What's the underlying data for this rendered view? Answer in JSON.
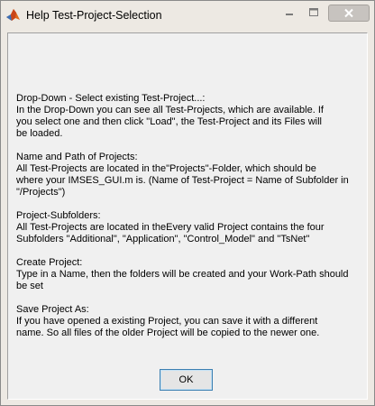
{
  "window": {
    "title": "Help Test-Project-Selection"
  },
  "colors": {
    "window_bg": "#ede9e3",
    "content_bg": "#f0f0f0",
    "button_border": "#3c7fb1"
  },
  "icons": [
    "matlab-logo-icon",
    "minimize-icon",
    "maximize-icon",
    "close-icon"
  ],
  "help": {
    "sections": [
      {
        "lines": [
          "Drop-Down - Select existing Test-Project...:",
          "In the Drop-Down you can see all Test-Projects, which are available. If",
          "you select one and then click \"Load\", the Test-Project and its Files will",
          "be loaded."
        ]
      },
      {
        "lines": [
          "Name and Path of Projects:",
          "All Test-Projects are located in the\"Projects\"-Folder, which should be",
          "where your IMSES_GUI.m is. (Name of Test-Project = Name of Subfolder in",
          "\"/Projects\")"
        ]
      },
      {
        "lines": [
          "Project-Subfolders:",
          "All Test-Projects are located in theEvery valid Project contains the four",
          "Subfolders \"Additional\", \"Application\", \"Control_Model\" and \"TsNet\""
        ]
      },
      {
        "lines": [
          "Create Project:",
          "Type in a Name, then the folders will be created and your Work-Path should",
          "be set"
        ]
      },
      {
        "lines": [
          "Save Project As:",
          "If you have opened a existing Project, you can save it with a different",
          "name. So all files of the older Project will be copied to the  newer one."
        ]
      }
    ]
  },
  "buttons": {
    "ok_label": "OK"
  }
}
